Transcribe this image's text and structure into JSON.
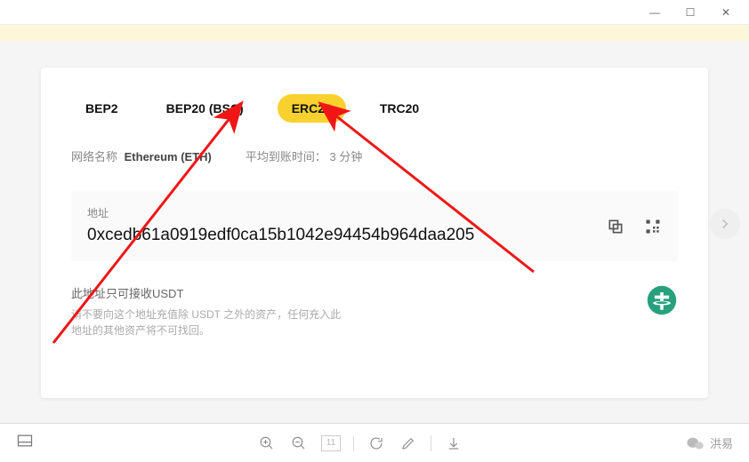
{
  "titlebar": {
    "minimize": "—",
    "maximize": "☐",
    "close": "✕"
  },
  "tabs": [
    {
      "label": "BEP2",
      "active": false
    },
    {
      "label": "BEP20 (BSC)",
      "active": false
    },
    {
      "label": "ERC20",
      "active": true
    },
    {
      "label": "TRC20",
      "active": false
    }
  ],
  "network": {
    "name_label": "网络名称",
    "name_value": "Ethereum (ETH)",
    "time_label": "平均到账时间：",
    "time_value": "3 分钟"
  },
  "address": {
    "label": "地址",
    "value": "0xcedb61a0919edf0ca15b1042e94454b964daa205"
  },
  "warning": {
    "title": "此地址只可接收USDT",
    "body": "请不要向这个地址充值除 USDT 之外的资产，任何充入此地址的其他资产将不可找回。"
  },
  "bottombar": {
    "page": "11",
    "brand": "洪易"
  }
}
